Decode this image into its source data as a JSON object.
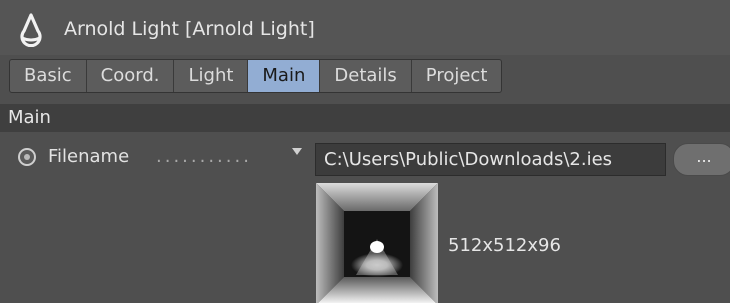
{
  "window": {
    "title": "Arnold Light [Arnold Light]",
    "icon": "arnold-light-icon"
  },
  "tabs": [
    {
      "label": "Basic",
      "active": false
    },
    {
      "label": "Coord.",
      "active": false
    },
    {
      "label": "Light",
      "active": false
    },
    {
      "label": "Main",
      "active": true
    },
    {
      "label": "Details",
      "active": false
    },
    {
      "label": "Project",
      "active": false
    }
  ],
  "section": {
    "title": "Main"
  },
  "filename_param": {
    "label": "Filename",
    "dots": "...........",
    "value": "C:\\Users\\Public\\Downloads\\2.ies",
    "browse_label": "..."
  },
  "preview": {
    "info": "512x512x96"
  },
  "colors": {
    "background": "#4f4f4f",
    "titlebar": "#555555",
    "tab": "#5c5c5c",
    "active_tab": "#92add3",
    "section_header": "#3f3f3f",
    "field": "#3c3c3c"
  }
}
